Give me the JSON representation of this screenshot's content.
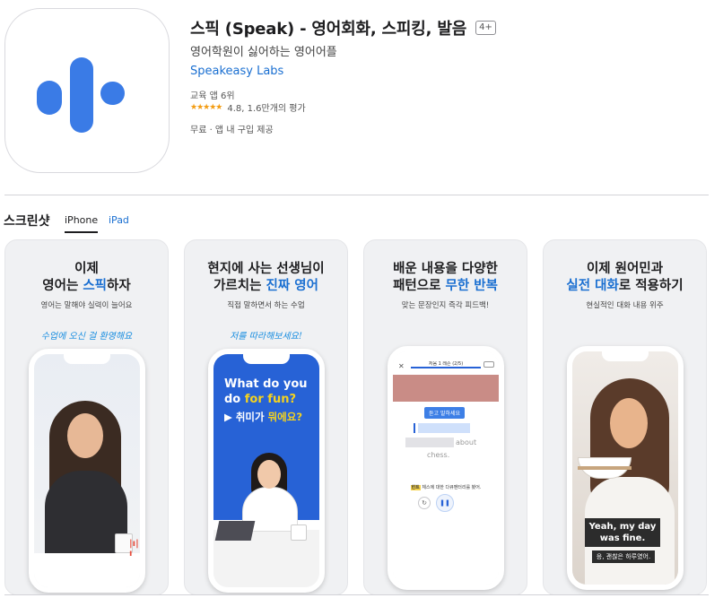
{
  "app": {
    "title": "스픽 (Speak) - 영어회화, 스피킹, 발음",
    "age_rating": "4+",
    "subtitle": "영어학원이 싫어하는 영어어플",
    "developer": "Speakeasy Labs",
    "rank": "교육 앱 6위",
    "stars": "★★★★★",
    "rating": "4.8, 1.6만개의 평가",
    "price": "무료 · 앱 내 구입 제공",
    "icon_color": "#3a7be6"
  },
  "screenshots": {
    "title": "스크린샷",
    "tabs": [
      "iPhone",
      "iPad"
    ],
    "cards": [
      {
        "line1": "이제",
        "line2_pre": "영어는 ",
        "line2_hl": "스픽",
        "line2_post": "하자",
        "desc": "영어는 말해야 실력이 늘어요",
        "note": "수업에 오신 걸 환영해요"
      },
      {
        "line1": "현지에 사는 선생님이",
        "line2_pre": "가르치는 ",
        "line2_hl": "진짜 영어",
        "line2_post": "",
        "desc": "직접 말하면서 하는 수업",
        "note": "저를 따라해보세요!",
        "screen": {
          "en_line1": "What do you",
          "en_line2_pre": "do ",
          "en_line2_hl": "for fun?",
          "kr_pre": "▶ 취미가 ",
          "kr_hl": "뭐에요?"
        }
      },
      {
        "line1": "배운 내용을 다양한",
        "line2_pre": "패턴으로 ",
        "line2_hl": "무한 반복",
        "line2_post": "",
        "desc": "맞는 문장인지 즉각 피드백!",
        "note": "",
        "screen": {
          "header": "처음 1 레슨 (2/5)",
          "question": "듣고 말하세요",
          "word_about": "about",
          "word_chess": "chess.",
          "hint_tag": "힌트",
          "hint": "체스에 대한 다큐멘터리를 봤어."
        }
      },
      {
        "line1": "이제 원어민과",
        "line2_pre": "",
        "line2_hl": "실전 대화",
        "line2_post": "로 적용하기",
        "desc": "현실적인 대화 내용 위주",
        "note": "",
        "screen": {
          "caption_en_1": "Yeah, my day",
          "caption_en_2": "was fine.",
          "caption_kr": "응, 괜찮은 하루였어."
        }
      }
    ]
  },
  "colors": {
    "accent": "#1a6fd1",
    "highlight": "#f4d21e",
    "card_bg": "#f0f1f3"
  }
}
